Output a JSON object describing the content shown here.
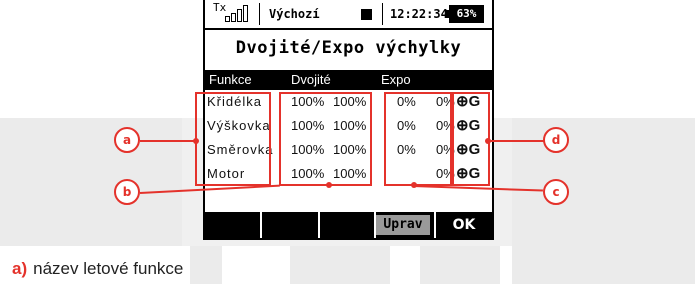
{
  "status": {
    "tx_label": "Tx",
    "model_name": "Výchozí",
    "time": "12:22:34",
    "battery": "63%"
  },
  "title": "Dvojité/Expo výchylky",
  "columns": {
    "function": "Funkce",
    "dual": "Dvojité",
    "expo": "Expo"
  },
  "rows": [
    {
      "name": "Křidélka",
      "dual1": "100%",
      "dual2": "100%",
      "expo1": "0%",
      "expo2": "0%",
      "icons": "⊕G"
    },
    {
      "name": "Výškovka",
      "dual1": "100%",
      "dual2": "100%",
      "expo1": "0%",
      "expo2": "0%",
      "icons": "⊕G"
    },
    {
      "name": "Směrovka",
      "dual1": "100%",
      "dual2": "100%",
      "expo1": "0%",
      "expo2": "0%",
      "icons": "⊕G"
    },
    {
      "name": "Motor",
      "dual1": "100%",
      "dual2": "100%",
      "expo1": "",
      "expo2": "0%",
      "icons": "⊕G"
    }
  ],
  "buttons": {
    "edit": "Uprav",
    "ok": "OK"
  },
  "callouts": {
    "a": "a",
    "b": "b",
    "c": "c",
    "d": "d"
  },
  "caption": {
    "label": "a)",
    "text": "název letové funkce"
  },
  "colors": {
    "accent": "#e4322b",
    "screen_bg": "#ffffff",
    "bar_bg": "#000000"
  }
}
